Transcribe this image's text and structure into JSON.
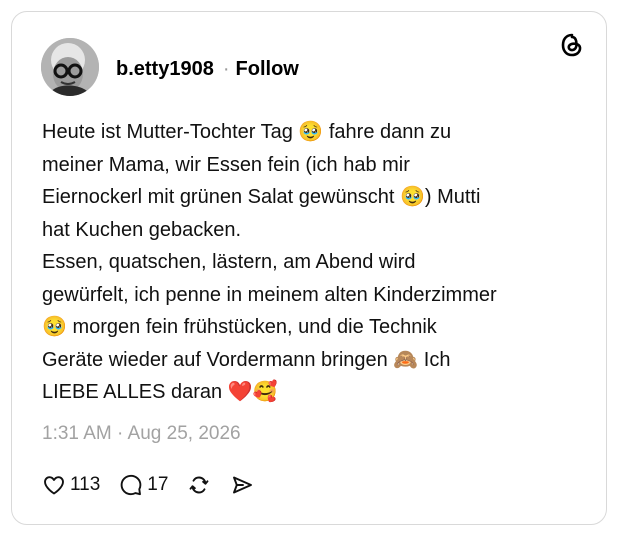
{
  "post": {
    "author": {
      "username": "b.etty1908",
      "separator": "·",
      "follow_label": "Follow"
    },
    "text": "Heute ist Mutter-Tochter Tag 🥹 fahre dann zu\nmeiner Mama, wir Essen fein (ich hab mir\nEiernockerl mit grünen Salat gewünscht 🥹) Mutti\nhat Kuchen gebacken.\nEssen, quatschen, lästern, am Abend wird\ngewürfelt, ich penne in meinem alten Kinderzimmer\n🥹 morgen fein frühstücken, und die Technik\nGeräte wieder auf Vordermann bringen 🙈 Ich\nLIEBE ALLES daran ❤️🥰",
    "timestamp": "1:31 AM · Aug 25, 2026",
    "stats": {
      "likes": "113",
      "replies": "17"
    }
  },
  "icons": {
    "logo": "threads-logo-icon",
    "like": "heart-icon",
    "reply": "comment-bubble-icon",
    "repost": "repost-icon",
    "share": "send-icon"
  },
  "colors": {
    "text": "#000000",
    "muted": "#a2a2a2",
    "border": "#d9d9d9"
  }
}
